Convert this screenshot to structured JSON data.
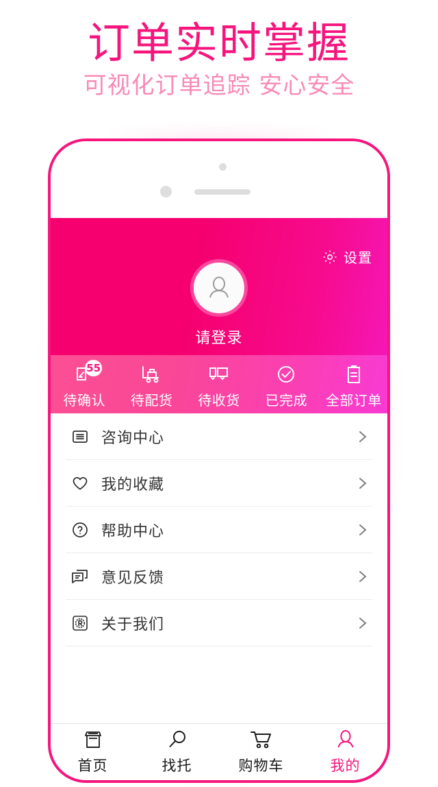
{
  "promo": {
    "title": "订单实时掌握",
    "subtitle": "可视化订单追踪 安心安全",
    "title_color": "#F5157D",
    "subtitle_color": "#F88BB5"
  },
  "app": {
    "header": {
      "settings_label": "设置",
      "settings_icon": "gear-icon",
      "avatar_icon": "person-avatar-icon",
      "login_label": "请登录",
      "gradient_from": "#F5006E",
      "gradient_to": "#F517B6"
    },
    "order_status": {
      "gradient_from": "#FB4F94",
      "gradient_to": "#F93AD4",
      "items": [
        {
          "label": "待确认",
          "icon": "pending-confirm-icon",
          "badge": "55"
        },
        {
          "label": "待配货",
          "icon": "delivery-cart-icon",
          "badge": ""
        },
        {
          "label": "待收货",
          "icon": "truck-box-icon",
          "badge": ""
        },
        {
          "label": "已完成",
          "icon": "check-circle-icon",
          "badge": ""
        },
        {
          "label": "全部订单",
          "icon": "clipboard-icon",
          "badge": ""
        }
      ]
    },
    "menu": {
      "items": [
        {
          "label": "咨询中心",
          "icon": "list-lines-icon"
        },
        {
          "label": "我的收藏",
          "icon": "heart-icon"
        },
        {
          "label": "帮助中心",
          "icon": "question-circle-icon"
        },
        {
          "label": "意见反馈",
          "icon": "feedback-bubble-icon"
        },
        {
          "label": "关于我们",
          "icon": "registered-seal-icon"
        }
      ]
    },
    "bottom_nav": {
      "active_color": "#F5157D",
      "items": [
        {
          "label": "首页",
          "icon": "store-icon",
          "active": false
        },
        {
          "label": "找托",
          "icon": "magnifier-icon",
          "active": false
        },
        {
          "label": "购物车",
          "icon": "shopping-cart-icon",
          "active": false
        },
        {
          "label": "我的",
          "icon": "person-icon",
          "active": true
        }
      ]
    }
  }
}
